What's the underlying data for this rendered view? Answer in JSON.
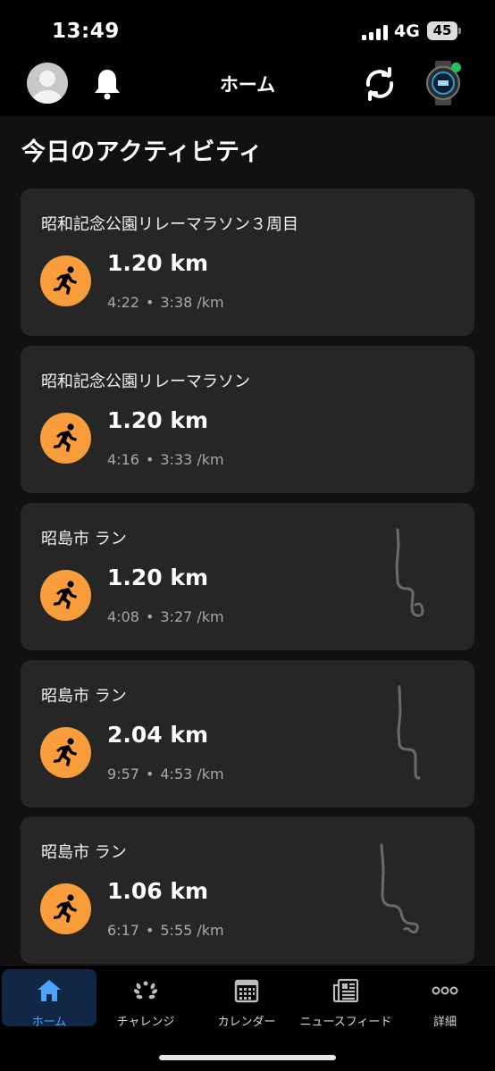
{
  "status_bar": {
    "time": "13:49",
    "network": "4G",
    "battery": "45"
  },
  "header": {
    "title": "ホーム",
    "icons": [
      "avatar",
      "bell-icon",
      "sync-icon",
      "watch-icon"
    ]
  },
  "section_title": "今日のアクティビティ",
  "activities": [
    {
      "title": "昭和記念公園リレーマラソン３周目",
      "distance": "1.20 km",
      "duration": "4:22",
      "pace": "3:38 /km",
      "has_route": false
    },
    {
      "title": "昭和記念公園リレーマラソン",
      "distance": "1.20 km",
      "duration": "4:16",
      "pace": "3:33 /km",
      "has_route": false
    },
    {
      "title": "昭島市 ラン",
      "distance": "1.20 km",
      "duration": "4:08",
      "pace": "3:27 /km",
      "has_route": true
    },
    {
      "title": "昭島市 ラン",
      "distance": "2.04 km",
      "duration": "9:57",
      "pace": "4:53 /km",
      "has_route": true
    },
    {
      "title": "昭島市 ラン",
      "distance": "1.06 km",
      "duration": "6:17",
      "pace": "5:55 /km",
      "has_route": true
    }
  ],
  "separator": "•",
  "nav": [
    {
      "label": "ホーム",
      "icon": "home-icon",
      "active": true
    },
    {
      "label": "チャレンジ",
      "icon": "laurel-icon",
      "active": false
    },
    {
      "label": "カレンダー",
      "icon": "calendar-icon",
      "active": false
    },
    {
      "label": "ニュースフィード",
      "icon": "newsfeed-icon",
      "active": false
    },
    {
      "label": "詳細",
      "icon": "more-icon",
      "active": false
    }
  ],
  "colors": {
    "accent_orange": "#f99d3a",
    "active_blue": "#4da3ff",
    "card_bg": "#262626"
  }
}
